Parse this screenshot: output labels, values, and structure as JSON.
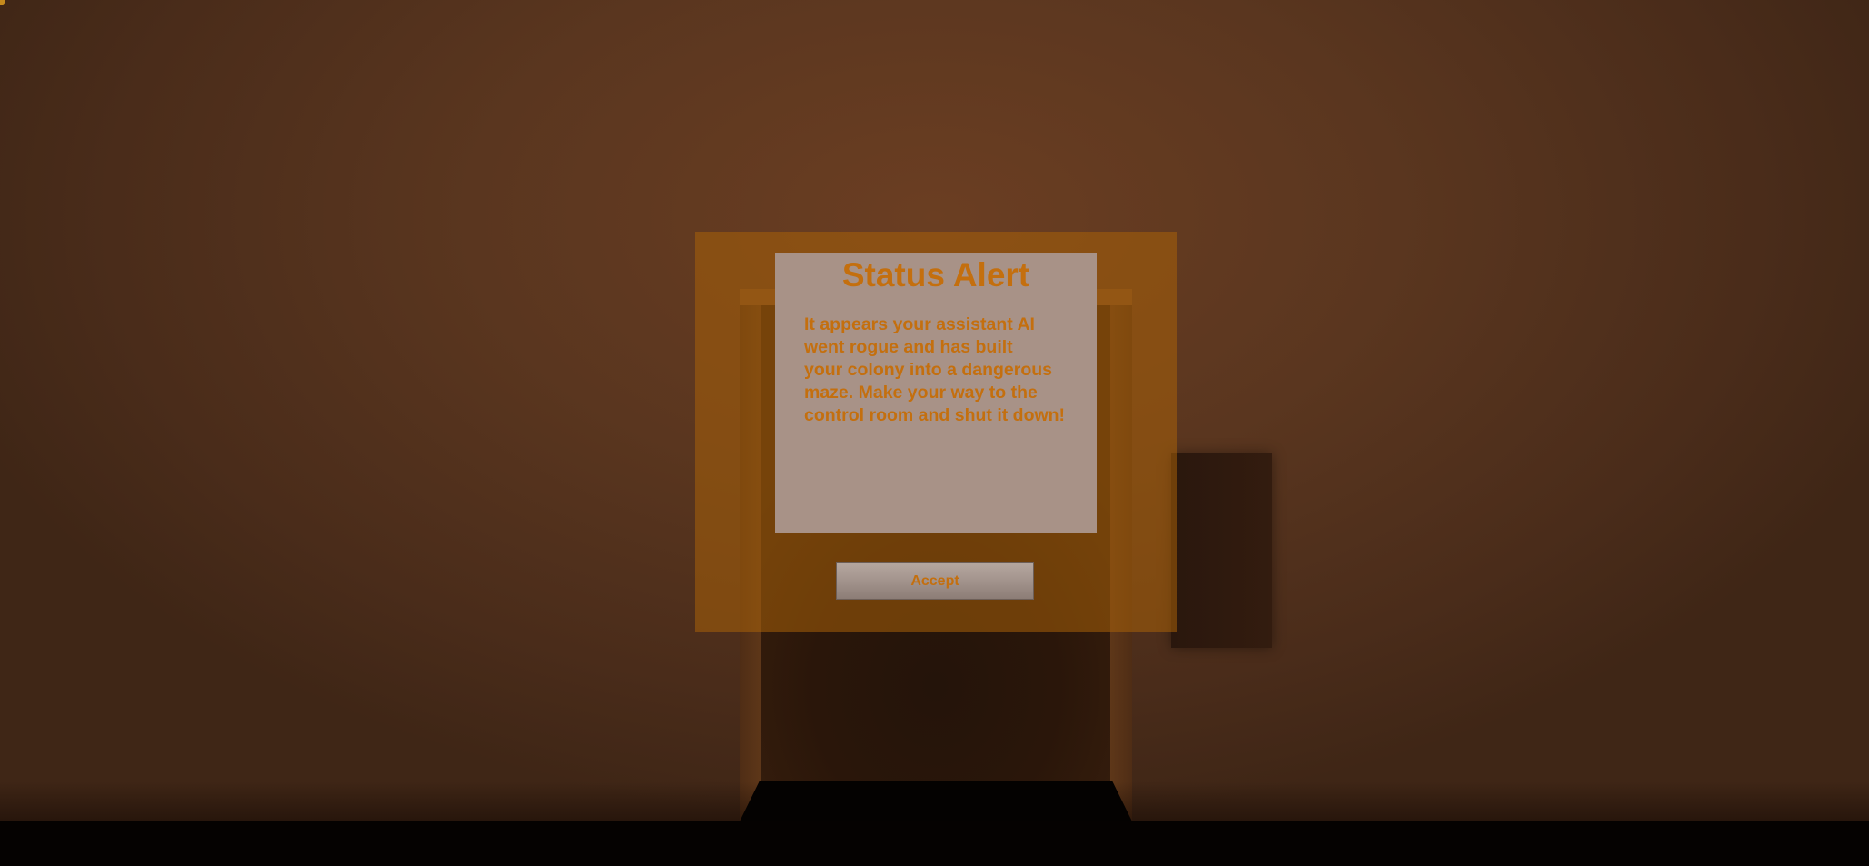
{
  "alert": {
    "title": "Status Alert",
    "message": "It appears your assistant AI\nwent rogue and has built\nyour colony into a dangerous\nmaze. Make your way to the\ncontrol room and shut it down!",
    "accept_label": "Accept"
  },
  "colors": {
    "accent_text": "#c46f0e",
    "overlay": "#a8600a",
    "card": "#a89287",
    "wall": "#5a361f"
  }
}
